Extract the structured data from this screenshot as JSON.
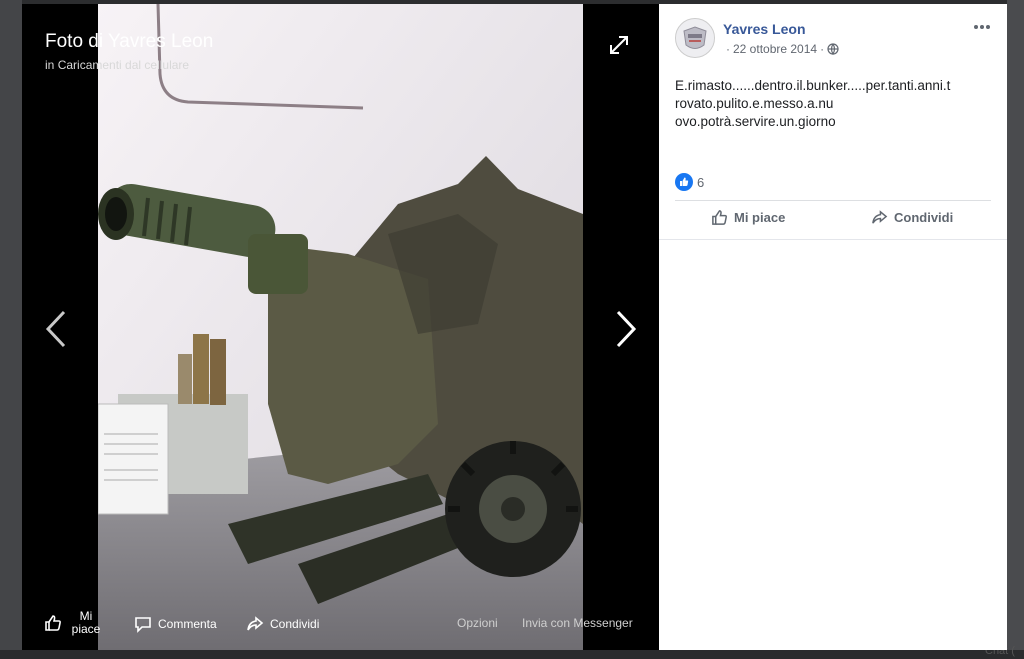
{
  "stage": {
    "title": "Foto di Yavres Leon",
    "sub_prefix": "in",
    "album": "Caricamenti dal cellulare",
    "bottom": {
      "like_label": "Mi\npiace",
      "comment_label": "Commenta",
      "share_label": "Condividi",
      "options_label": "Opzioni",
      "messenger_label": "Invia con Messenger"
    }
  },
  "post": {
    "author": "Yavres Leon",
    "date": "22 ottobre 2014",
    "meta_sep": "·",
    "text": "E.rimasto......dentro.il.bunker.....per.tanti.anni.t\nrovato.pulito.e.messo.a.nu\novo.potrà.servire.un.giorno",
    "likes_count": "6",
    "like_action": "Mi piace",
    "share_action": "Condividi"
  },
  "page_corner_text": "Chat (",
  "colors": {
    "link_blue": "#385898",
    "like_blue": "#1877f2"
  }
}
